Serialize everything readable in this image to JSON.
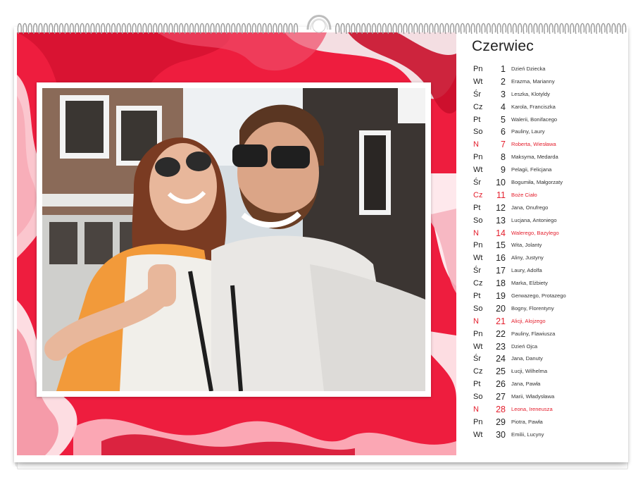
{
  "calendar": {
    "month": "Czerwiec",
    "days": [
      {
        "weekday": "Pn",
        "day": "1",
        "names": "Dzień Dziecka",
        "holiday": false
      },
      {
        "weekday": "Wt",
        "day": "2",
        "names": "Erazma, Marianny",
        "holiday": false
      },
      {
        "weekday": "Śr",
        "day": "3",
        "names": "Leszka, Klotyldy",
        "holiday": false
      },
      {
        "weekday": "Cz",
        "day": "4",
        "names": "Karola, Franciszka",
        "holiday": false
      },
      {
        "weekday": "Pt",
        "day": "5",
        "names": "Walerii, Bonifacego",
        "holiday": false
      },
      {
        "weekday": "So",
        "day": "6",
        "names": "Pauliny, Laury",
        "holiday": false
      },
      {
        "weekday": "N",
        "day": "7",
        "names": "Roberta, Wiesława",
        "holiday": true
      },
      {
        "weekday": "Pn",
        "day": "8",
        "names": "Maksyma, Medarda",
        "holiday": false
      },
      {
        "weekday": "Wt",
        "day": "9",
        "names": "Pelagii, Felicjana",
        "holiday": false
      },
      {
        "weekday": "Śr",
        "day": "10",
        "names": "Bogumiła, Małgorzaty",
        "holiday": false
      },
      {
        "weekday": "Cz",
        "day": "11",
        "names": "Boże Ciało",
        "holiday": true
      },
      {
        "weekday": "Pt",
        "day": "12",
        "names": "Jana, Onufrego",
        "holiday": false
      },
      {
        "weekday": "So",
        "day": "13",
        "names": "Lucjana, Antoniego",
        "holiday": false
      },
      {
        "weekday": "N",
        "day": "14",
        "names": "Walerego, Bazylego",
        "holiday": true
      },
      {
        "weekday": "Pn",
        "day": "15",
        "names": "Wita, Jolanty",
        "holiday": false
      },
      {
        "weekday": "Wt",
        "day": "16",
        "names": "Aliny, Justyny",
        "holiday": false
      },
      {
        "weekday": "Śr",
        "day": "17",
        "names": "Laury, Adolfa",
        "holiday": false
      },
      {
        "weekday": "Cz",
        "day": "18",
        "names": "Marka, Elżbiety",
        "holiday": false
      },
      {
        "weekday": "Pt",
        "day": "19",
        "names": "Gerwazego, Protazego",
        "holiday": false
      },
      {
        "weekday": "So",
        "day": "20",
        "names": "Bogny, Florentyny",
        "holiday": false
      },
      {
        "weekday": "N",
        "day": "21",
        "names": "Alicji, Alojzego",
        "holiday": true
      },
      {
        "weekday": "Pn",
        "day": "22",
        "names": "Pauliny, Flawiusza",
        "holiday": false
      },
      {
        "weekday": "Wt",
        "day": "23",
        "names": "Dzień Ojca",
        "holiday": false
      },
      {
        "weekday": "Śr",
        "day": "24",
        "names": "Jana, Danuty",
        "holiday": false
      },
      {
        "weekday": "Cz",
        "day": "25",
        "names": "Łucji, Wilhelma",
        "holiday": false
      },
      {
        "weekday": "Pt",
        "day": "26",
        "names": "Jana, Pawła",
        "holiday": false
      },
      {
        "weekday": "So",
        "day": "27",
        "names": "Marii, Władysława",
        "holiday": false
      },
      {
        "weekday": "N",
        "day": "28",
        "names": "Leona, Ireneusza",
        "holiday": true
      },
      {
        "weekday": "Pn",
        "day": "29",
        "names": "Piotra, Pawła",
        "holiday": false
      },
      {
        "weekday": "Wt",
        "day": "30",
        "names": "Emilii, Lucyny",
        "holiday": false
      }
    ]
  },
  "colors": {
    "background_art": "#ee1d3e",
    "holiday_text": "#e4202e"
  }
}
